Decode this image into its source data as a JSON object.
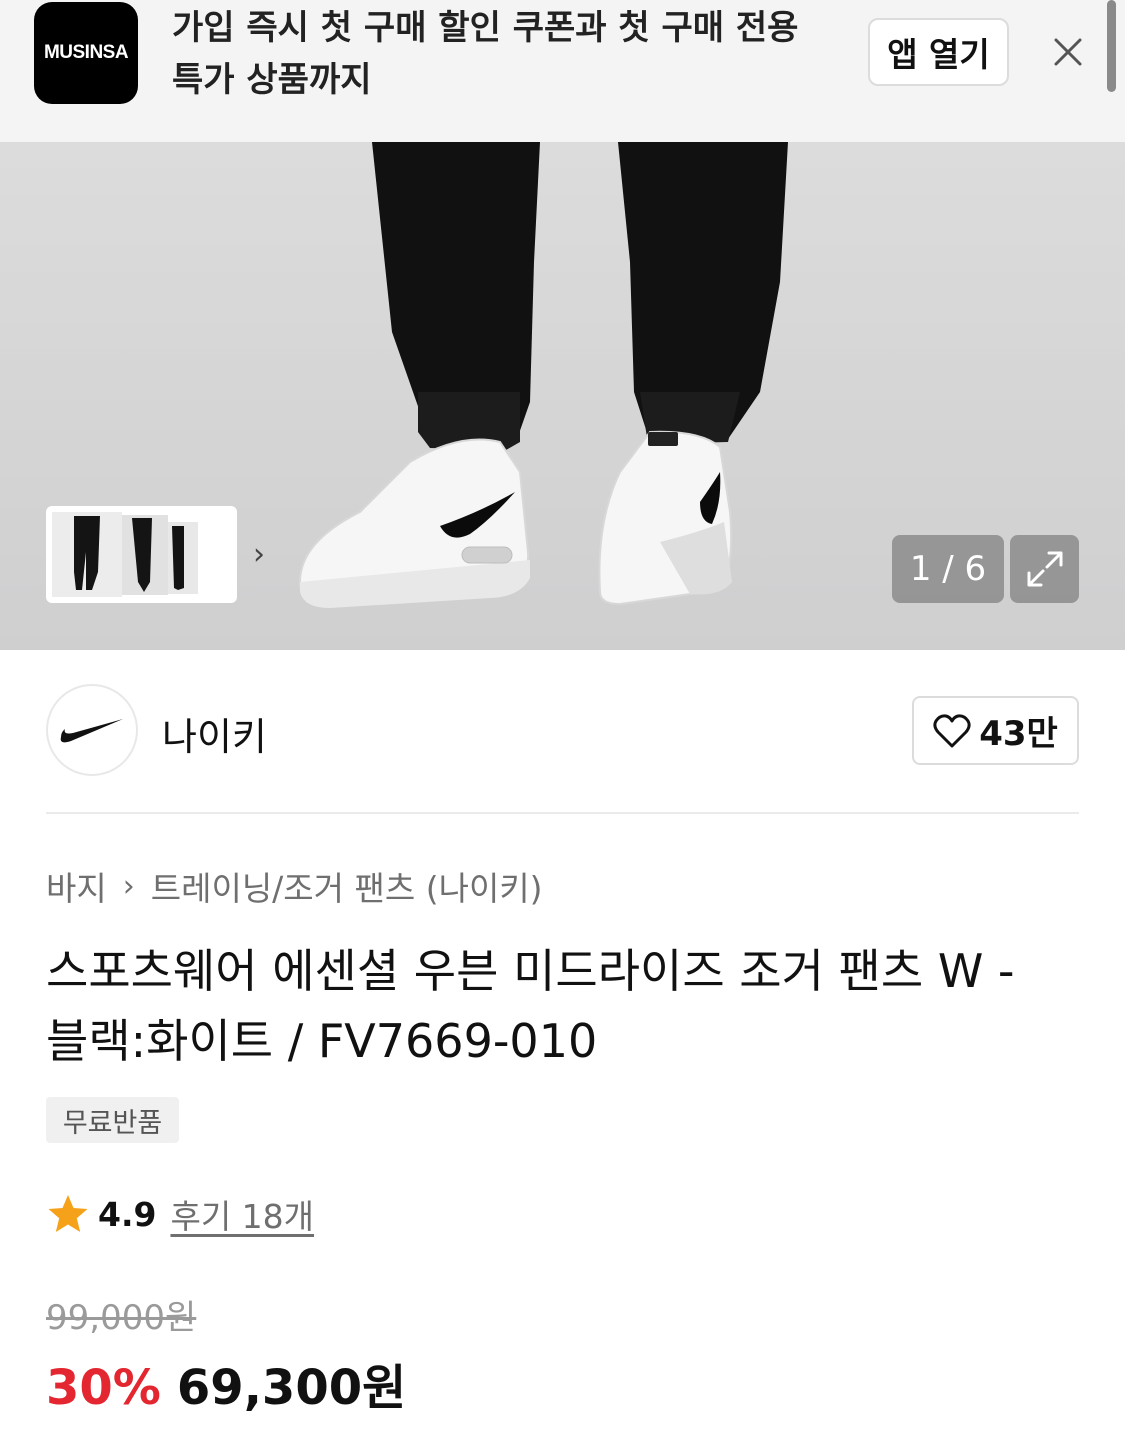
{
  "banner": {
    "logo_text": "MUSINSA",
    "line1": "가입 즉시 첫 구매 할인 쿠폰과 첫 구매 전용",
    "line2": "특가 상품까지",
    "open_app_label": "앱 열기",
    "close_icon": "close-icon"
  },
  "gallery": {
    "counter": "1 / 6",
    "next_icon": "chevron-right-icon",
    "expand_icon": "expand-icon"
  },
  "brand": {
    "name": "나이키",
    "logo_icon": "nike-swoosh-logo",
    "like_icon": "heart-icon",
    "like_count": "43만"
  },
  "breadcrumb": {
    "category": "바지",
    "separator_icon": "chevron-right-icon",
    "subcategory": "트레이닝/조거 팬츠 (나이키)"
  },
  "product": {
    "title_line1": "스포츠웨어 에센셜 우븐 미드라이즈 조거 팬츠 W -",
    "title_line2": "블랙:화이트 / FV7669-010",
    "tag": "무료반품"
  },
  "rating": {
    "star_icon": "star-icon",
    "value": "4.9",
    "reviews": "후기 18개"
  },
  "price": {
    "original": "99,000원",
    "discount": "30%",
    "sale": "69,300원",
    "discount_color": "#e3262f"
  }
}
